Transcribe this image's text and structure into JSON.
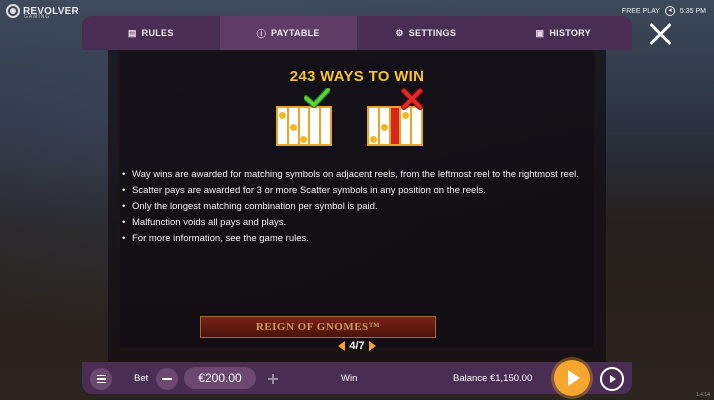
{
  "brand": {
    "name": "REVOLVER",
    "sub": "GAMING"
  },
  "status": {
    "mode": "FREE PLAY",
    "time": "5:35 PM"
  },
  "tabs": [
    {
      "label": "RULES",
      "icon": "book-icon"
    },
    {
      "label": "PAYTABLE",
      "icon": "info-icon"
    },
    {
      "label": "SETTINGS",
      "icon": "gear-icon"
    },
    {
      "label": "HISTORY",
      "icon": "history-icon"
    }
  ],
  "active_tab": "PAYTABLE",
  "page": {
    "title": "243 WAYS TO WIN",
    "rules": [
      "Way wins are awarded for matching symbols on adjacent reels, from the leftmost reel to the rightmost reel.",
      "Scatter pays are awarded for 3 or more Scatter symbols in any position on the reels.",
      "Only the longest matching combination per symbol is paid.",
      "Malfunction voids all pays and plays.",
      "For more information, see the game rules."
    ],
    "pager": "4/7",
    "banner": "REIGN OF GNOMES™"
  },
  "footer": {
    "bet_label": "Bet",
    "bet_value": "€200.00",
    "win_label": "Win",
    "balance": "Balance €1,150.00"
  },
  "version": "1.4.14",
  "colors": {
    "accent": "#f6a52d",
    "title": "#f6c430",
    "bar": "#4a2d52",
    "tab_active": "#5f3c66"
  }
}
